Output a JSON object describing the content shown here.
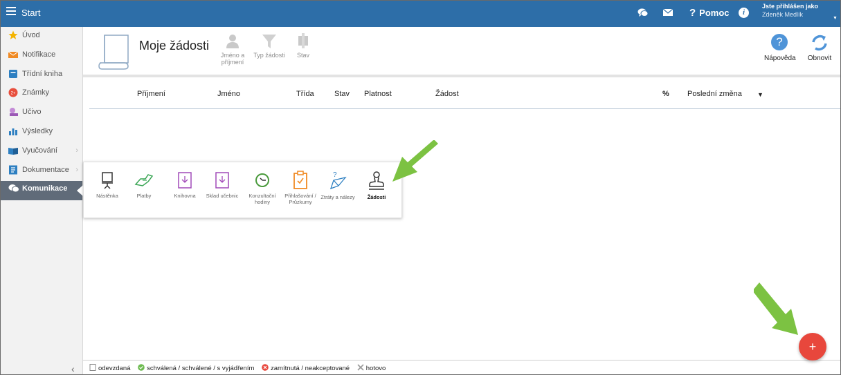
{
  "topbar": {
    "title": "Start",
    "help_label": "Pomoc",
    "help_symbol": "?",
    "info_symbol": "i",
    "user_line1": "Jste přihlášen jako",
    "user_line2": "Zdeněk Medlík",
    "icons": [
      "chat-icon",
      "mail-icon",
      "info-icon"
    ]
  },
  "sidebar": {
    "items": [
      {
        "label": "Úvod",
        "icon": "star-icon",
        "color": "#f4b400"
      },
      {
        "label": "Notifikace",
        "icon": "mail-icon",
        "color": "#f08a24"
      },
      {
        "label": "Třídní kniha",
        "icon": "book-icon",
        "color": "#2d7fc1"
      },
      {
        "label": "Známky",
        "icon": "grades-icon",
        "color": "#e84e3c"
      },
      {
        "label": "Učivo",
        "icon": "curriculum-icon",
        "color": "#9b59b6"
      },
      {
        "label": "Výsledky",
        "icon": "chart-icon",
        "color": "#2d7fc1"
      },
      {
        "label": "Vyučování",
        "icon": "teaching-icon",
        "color": "#2d7fc1"
      },
      {
        "label": "Dokumentace",
        "icon": "documentation-icon",
        "color": "#2d7fc1"
      },
      {
        "label": "Komunikace",
        "icon": "communication-icon",
        "color": "#ffffff"
      }
    ],
    "chevron": "›",
    "collapse": "‹"
  },
  "header": {
    "title": "Moje žádosti",
    "filters": [
      {
        "label": "Jméno a příjmení"
      },
      {
        "label": "Typ žádosti"
      },
      {
        "label": "Stav"
      }
    ],
    "help_label": "Nápověda",
    "help_symbol": "?",
    "refresh_label": "Obnovit"
  },
  "table": {
    "columns": [
      "Příjmení",
      "Jméno",
      "Třída",
      "Stav",
      "Platnost",
      "Žádost",
      "Poslední změna"
    ],
    "link_symbol": "%",
    "sort_symbol": "▼"
  },
  "popup": {
    "items": [
      {
        "label": "Nástěnka",
        "color": "#333333"
      },
      {
        "label": "Platby",
        "color": "#3aa655"
      },
      {
        "label": "Knihovna",
        "color": "#a14ab8"
      },
      {
        "label": "Sklad učebnic",
        "color": "#a14ab8"
      },
      {
        "label": "Konzultační hodiny",
        "color": "#4a9a3c"
      },
      {
        "label": "Přihlašování / Průzkumy",
        "color": "#f08a24"
      },
      {
        "label": "Ztráty a nálezy",
        "color": "#2d7fc1"
      },
      {
        "label": "Žádosti",
        "color": "#333333"
      }
    ]
  },
  "legend": {
    "items": [
      {
        "label": "odevzdaná",
        "color": "#888888"
      },
      {
        "label": "schválená / schválené / s vyjádřením",
        "color": "#6dbb50"
      },
      {
        "label": "zamítnutá / neakceptované",
        "color": "#e8473c"
      },
      {
        "label": "hotovo",
        "color": "#888888"
      }
    ]
  },
  "fab": {
    "symbol": "+"
  },
  "colors": {
    "topbar": "#2d6ea8",
    "sidebar_active": "#606b79",
    "arrow": "#7cc242",
    "fab": "#e8473c"
  }
}
